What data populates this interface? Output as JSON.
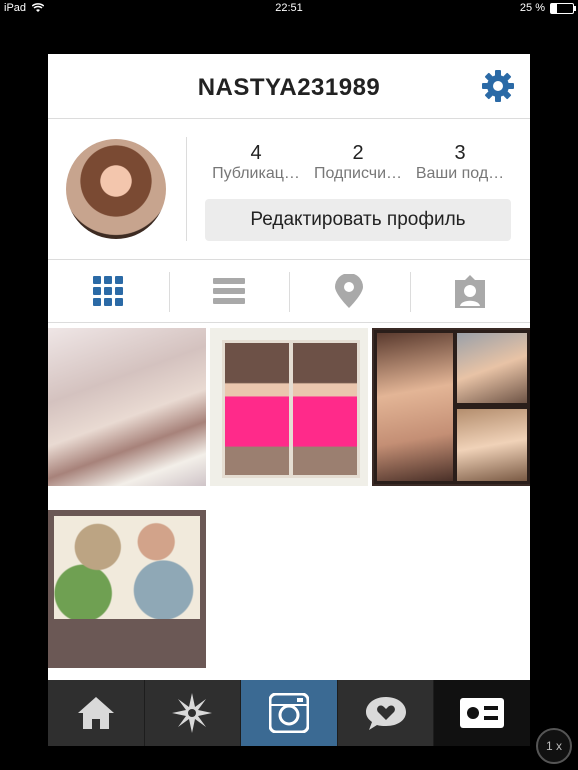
{
  "status_bar": {
    "device": "iPad",
    "time": "22:51",
    "battery": "25 %",
    "battery_level": 0.25
  },
  "header": {
    "username": "NASTYA231989",
    "settings_icon": "gear-icon"
  },
  "profile": {
    "stats": [
      {
        "count": "4",
        "label": "Публикац…"
      },
      {
        "count": "2",
        "label": "Подписчи…"
      },
      {
        "count": "3",
        "label": "Ваши под…"
      }
    ],
    "edit_button": "Редактировать профиль"
  },
  "view_tabs": [
    {
      "icon": "grid-icon",
      "active": true
    },
    {
      "icon": "list-icon",
      "active": false
    },
    {
      "icon": "map-pin-icon",
      "active": false
    },
    {
      "icon": "tagged-user-icon",
      "active": false
    }
  ],
  "photos_count": 4,
  "bottom_tabs": [
    {
      "icon": "home-icon"
    },
    {
      "icon": "explore-star-icon"
    },
    {
      "icon": "camera-icon",
      "active": true
    },
    {
      "icon": "activity-heart-bubble-icon"
    },
    {
      "icon": "profile-card-icon"
    }
  ],
  "zoom_indicator": "1 x",
  "colors": {
    "accent": "#3b6a93",
    "tabbar": "#2f2f2f",
    "gear": "#2b6aa6"
  }
}
